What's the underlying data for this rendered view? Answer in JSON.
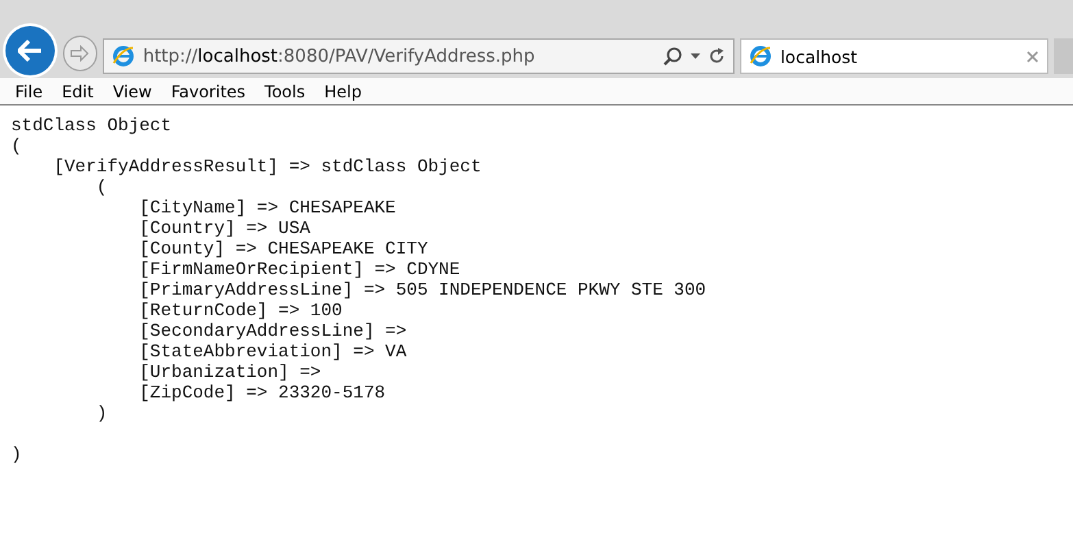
{
  "address_bar": {
    "url": "http://**localhost**:8080/PAV/VerifyAddress.php"
  },
  "tabs": [
    {
      "label": "localhost",
      "selected": true
    }
  ],
  "menu": [
    "File",
    "Edit",
    "View",
    "Favorites",
    "Tools",
    "Help"
  ],
  "output_blocks": [
    [
      "stdClass Object",
      "(",
      "    [VerifyAddressResult] => stdClass Object",
      "        (",
      "            [CityName] => CHESAPEAKE",
      "            [Country] => USA",
      "            [County] => CHESAPEAKE CITY",
      "            [FirmNameOrRecipient] => CDYNE",
      "            [PrimaryAddressLine] => 505 INDEPENDENCE PKWY STE 300",
      "            [ReturnCode] => 100",
      "            [SecondaryAddressLine] =>",
      "            [StateAbbreviation] => VA",
      "            [Urbanization] =>",
      "            [ZipCode] => 23320-5178",
      "        )"
    ],
    [
      ")"
    ]
  ]
}
